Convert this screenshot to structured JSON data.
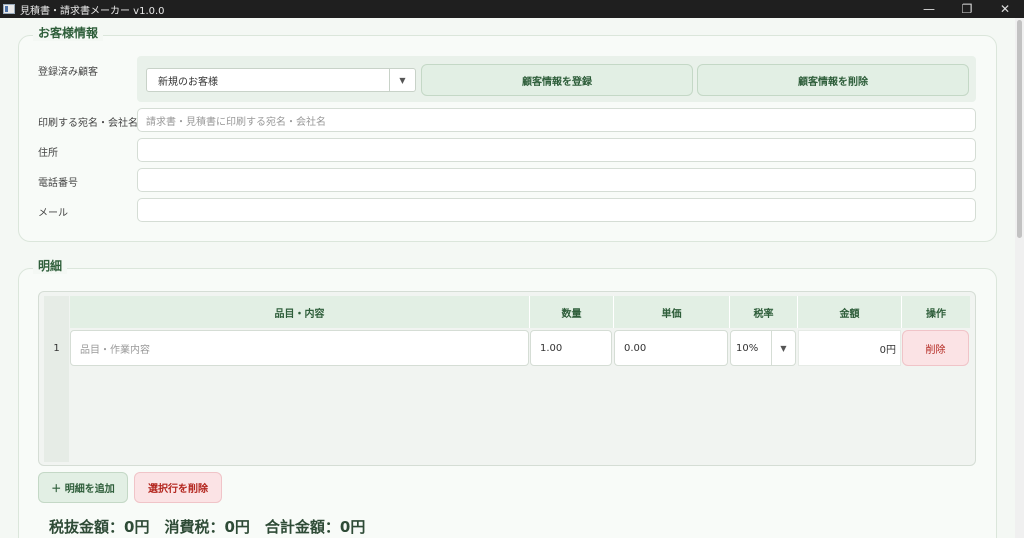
{
  "window": {
    "title": "見積書・請求書メーカー  v1.0.0",
    "minimize": "—",
    "restore": "❐",
    "close": "✕"
  },
  "customer": {
    "group_title": "お客様情報",
    "registered_label": "登録済み顧客",
    "combo_value": "新規のお客様",
    "register_button": "顧客情報を登録",
    "delete_button": "顧客情報を削除",
    "print_name_label": "印刷する宛名・会社名",
    "print_name_placeholder": "請求書・見積書に印刷する宛名・会社名",
    "address_label": "住所",
    "phone_label": "電話番号",
    "email_label": "メール"
  },
  "details": {
    "group_title": "明細",
    "columns": [
      "品目・内容",
      "数量",
      "単価",
      "税率",
      "金額",
      "操作"
    ],
    "rows": [
      {
        "num": "1",
        "item_placeholder": "品目・作業内容",
        "quantity": "1.00",
        "unit_price": "0.00",
        "tax_rate": "10%",
        "amount": "0円",
        "action": "削除"
      }
    ],
    "add_button": "＋ 明細を追加",
    "remove_selected_button": "選択行を削除"
  },
  "totals": {
    "text": "税抜金額：0円　消費税：0円　合計金額：0円"
  },
  "colors": {
    "accent": "#2e5e3a",
    "button_green": "#e2efe4",
    "button_red": "#fbe3e5",
    "danger_text": "#b3261e"
  }
}
